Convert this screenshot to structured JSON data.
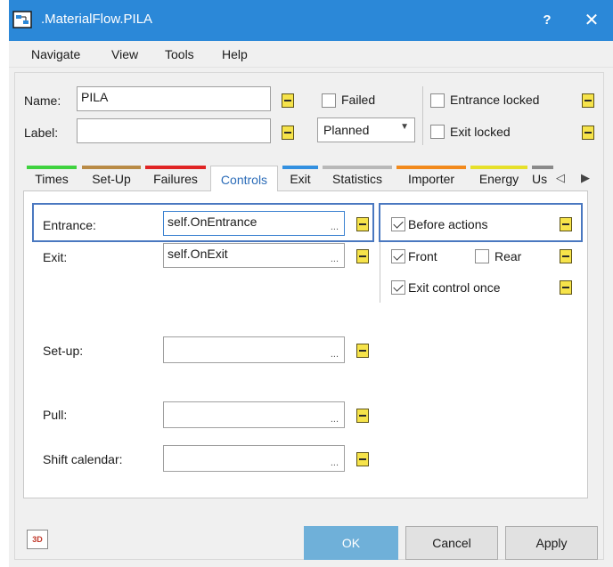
{
  "window": {
    "title": ".MaterialFlow.PILA",
    "help_label": "?",
    "close_label": "✕",
    "titlebar_color": "#2b88d8"
  },
  "menu": [
    "Navigate",
    "View",
    "Tools",
    "Help"
  ],
  "header": {
    "name_label": "Name:",
    "name_value": "PILA",
    "label_label": "Label:",
    "label_value": "",
    "failed_label": "Failed",
    "failed_checked": false,
    "status_value": "Planned",
    "entrance_locked_label": "Entrance locked",
    "entrance_locked_checked": false,
    "exit_locked_label": "Exit locked",
    "exit_locked_checked": false
  },
  "tabs": [
    {
      "label": "Times",
      "color": "#3fd23f"
    },
    {
      "label": "Set-Up",
      "color": "#b98b46"
    },
    {
      "label": "Failures",
      "color": "#e02424"
    },
    {
      "label": "Controls",
      "color": "#5bb4e3",
      "active": true
    },
    {
      "label": "Exit",
      "color": "#3390e0"
    },
    {
      "label": "Statistics",
      "color": "#b8b8b8"
    },
    {
      "label": "Importer",
      "color": "#f28a1c"
    },
    {
      "label": "Energy",
      "color": "#e6e02a"
    },
    {
      "label": "Us",
      "color": "#8a8a8a"
    }
  ],
  "tab_nav": {
    "prev": "◁",
    "next": "▶"
  },
  "controls": {
    "entrance_label": "Entrance:",
    "entrance_value": "self.OnEntrance",
    "exit_label": "Exit:",
    "exit_value": "self.OnExit",
    "setup_label": "Set-up:",
    "setup_value": "",
    "pull_label": "Pull:",
    "pull_value": "",
    "shift_calendar_label": "Shift calendar:",
    "shift_calendar_value": "",
    "ellipsis": "...",
    "before_actions_label": "Before actions",
    "before_actions_checked": true,
    "front_label": "Front",
    "front_checked": true,
    "rear_label": "Rear",
    "rear_checked": false,
    "exit_control_once_label": "Exit control once",
    "exit_control_once_checked": true
  },
  "footer": {
    "threed_label": "3D",
    "ok_label": "OK",
    "cancel_label": "Cancel",
    "apply_label": "Apply"
  }
}
